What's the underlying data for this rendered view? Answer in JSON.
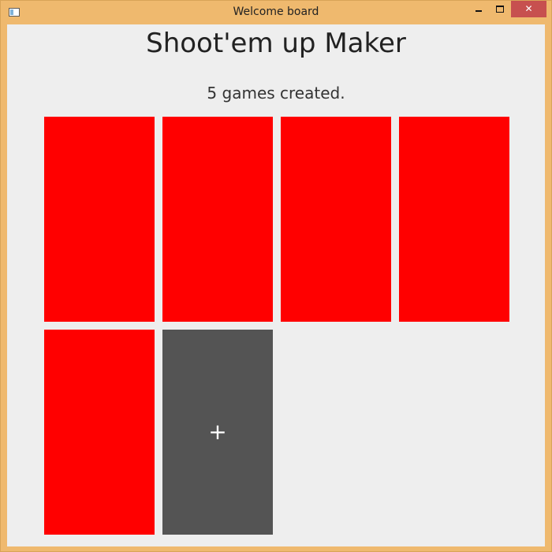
{
  "window": {
    "title": "Welcome board",
    "minimize_icon": "minimize-icon",
    "maximize_icon": "maximize-icon",
    "close_glyph": "✕"
  },
  "header": {
    "title": "Shoot'em up Maker",
    "status": "5 games created."
  },
  "games": [
    {
      "color": "#ff0000"
    },
    {
      "color": "#ff0000"
    },
    {
      "color": "#ff0000"
    },
    {
      "color": "#ff0000"
    },
    {
      "color": "#ff0000"
    }
  ],
  "add_tile": {
    "label": "+",
    "color": "#545454"
  },
  "colors": {
    "frame": "#efb96e",
    "client_bg": "#eeeeee",
    "close_button": "#c7504f"
  }
}
